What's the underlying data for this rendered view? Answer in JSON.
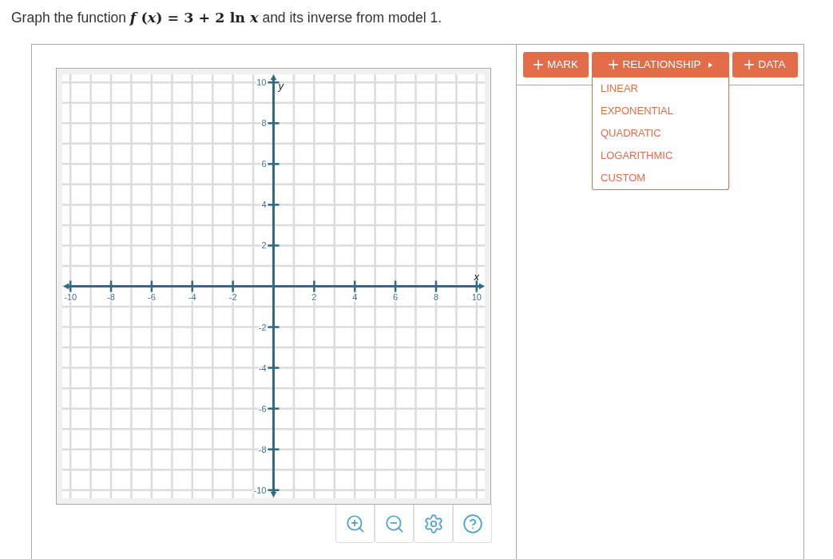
{
  "question": {
    "before": "Graph the function",
    "math": "*f* (*x*) = 3 + 2 ln *x*",
    "after": "and its inverse from model 1."
  },
  "graph": {
    "chart_data": {
      "type": "line",
      "xlabel": "x",
      "ylabel": "y",
      "xlim": [
        -10,
        10
      ],
      "ylim": [
        -10,
        10
      ],
      "xticks": [
        -10,
        -8,
        -6,
        -4,
        -2,
        2,
        4,
        6,
        8,
        10
      ],
      "yticks": [
        -10,
        -8,
        -6,
        -4,
        -2,
        2,
        4,
        6,
        8,
        10
      ],
      "grid": true
    }
  },
  "toolbar": [
    {
      "kind": "button",
      "label": "MARK"
    },
    {
      "kind": "menu",
      "label": "RELATIONSHIP",
      "expanded": true,
      "options": [
        "LINEAR",
        "EXPONENTIAL",
        "QUADRATIC",
        "LOGARITHMIC",
        "CUSTOM"
      ]
    },
    {
      "kind": "button",
      "label": "DATA"
    }
  ]
}
